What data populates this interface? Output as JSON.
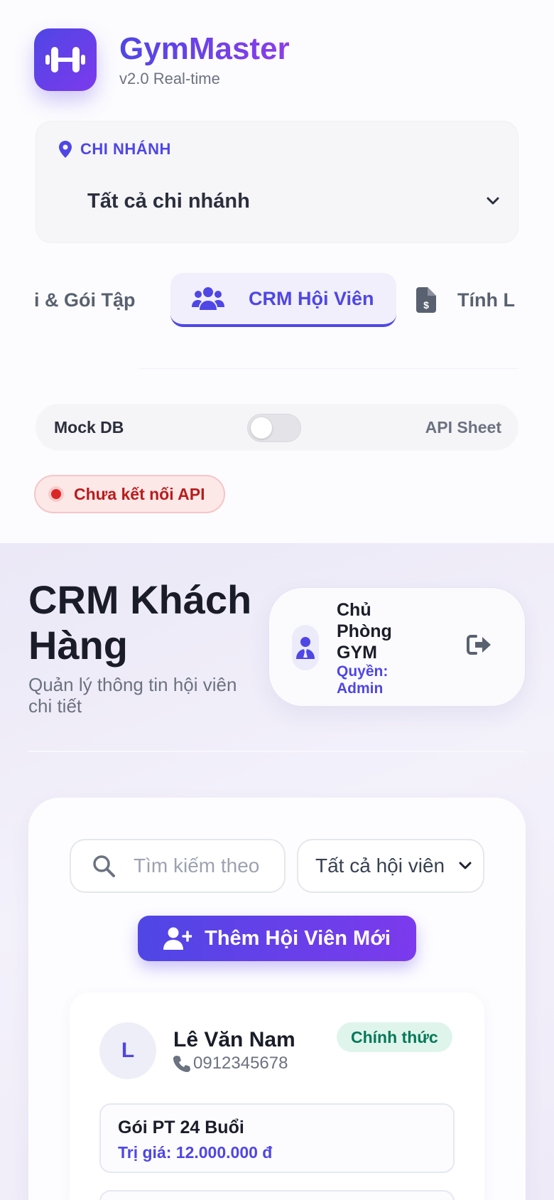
{
  "brand": {
    "title": "GymMaster",
    "subtitle": "v2.0 Real-time",
    "icon": "dumbbell-icon",
    "accent": "#4f46e5",
    "accent_end": "#7c3aed"
  },
  "branch": {
    "label": "CHI NHÁNH",
    "selected": "Tất cả chi nhánh"
  },
  "nav_tabs": [
    {
      "label": "i & Gói Tập",
      "icon": "",
      "active": false
    },
    {
      "label": "CRM Hội Viên",
      "icon": "users-icon",
      "active": true
    },
    {
      "label": "Tính L",
      "icon": "invoice-dollar-icon",
      "active": false
    }
  ],
  "data_source": {
    "left_label": "Mock DB",
    "right_label": "API Sheet",
    "api_enabled": false
  },
  "api_status": {
    "text": "Chưa kết nối API",
    "color": "#b91c1c"
  },
  "header": {
    "title": "CRM Khách Hàng",
    "subtitle": "Quản lý thông tin hội viên chi tiết"
  },
  "user": {
    "name": "Chủ Phòng GYM",
    "role": "Quyền: Admin"
  },
  "filters": {
    "search_placeholder": "Tìm kiếm theo",
    "member_filter": "Tất cả hội viên"
  },
  "actions": {
    "add_member": "Thêm Hội Viên Mới"
  },
  "members": [
    {
      "initial": "L",
      "name": "Lê Văn Nam",
      "phone": "0912345678",
      "status": "Chính thức",
      "status_color": "#047857",
      "package_name": "Gói PT 24 Buổi",
      "package_value": "Trị giá: 12.000.000 đ"
    }
  ]
}
